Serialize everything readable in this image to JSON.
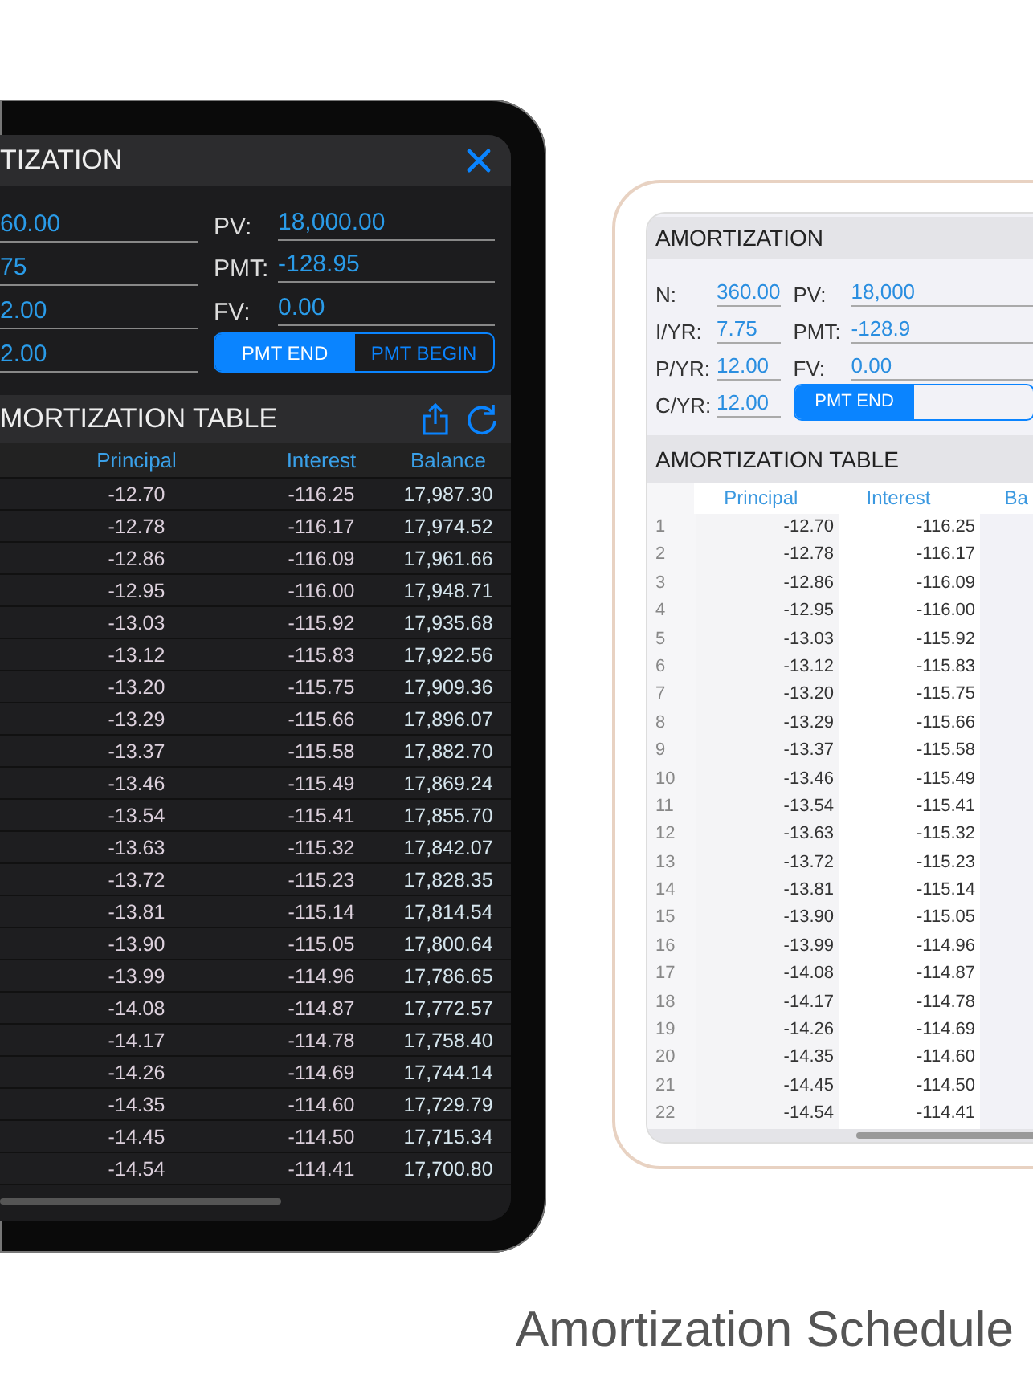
{
  "devices": [
    {
      "kind": "dark",
      "title": "TIZATION",
      "close": true,
      "left_fields": [
        {
          "value": "60.00"
        },
        {
          "value": "75"
        },
        {
          "value": "2.00"
        },
        {
          "value": "2.00"
        }
      ],
      "right_fields": [
        {
          "label": "PV:",
          "value": "18,000.00"
        },
        {
          "label": "PMT:",
          "value": "-128.95"
        },
        {
          "label": "FV:",
          "value": "0.00"
        }
      ],
      "segments": [
        {
          "label": "PMT END",
          "selected": true
        },
        {
          "label": "PMT BEGIN",
          "selected": false
        }
      ],
      "table_title": "MORTIZATION TABLE",
      "table_actions": true,
      "columns": [
        "Principal",
        "Interest",
        "Balance"
      ],
      "rows": [
        {
          "cells": [
            "-12.70",
            "-116.25",
            "17,987.30"
          ]
        },
        {
          "cells": [
            "-12.78",
            "-116.17",
            "17,974.52"
          ]
        },
        {
          "cells": [
            "-12.86",
            "-116.09",
            "17,961.66"
          ]
        },
        {
          "cells": [
            "-12.95",
            "-116.00",
            "17,948.71"
          ]
        },
        {
          "cells": [
            "-13.03",
            "-115.92",
            "17,935.68"
          ]
        },
        {
          "cells": [
            "-13.12",
            "-115.83",
            "17,922.56"
          ]
        },
        {
          "cells": [
            "-13.20",
            "-115.75",
            "17,909.36"
          ]
        },
        {
          "cells": [
            "-13.29",
            "-115.66",
            "17,896.07"
          ]
        },
        {
          "cells": [
            "-13.37",
            "-115.58",
            "17,882.70"
          ]
        },
        {
          "cells": [
            "-13.46",
            "-115.49",
            "17,869.24"
          ]
        },
        {
          "cells": [
            "-13.54",
            "-115.41",
            "17,855.70"
          ]
        },
        {
          "cells": [
            "-13.63",
            "-115.32",
            "17,842.07"
          ]
        },
        {
          "cells": [
            "-13.72",
            "-115.23",
            "17,828.35"
          ]
        },
        {
          "cells": [
            "-13.81",
            "-115.14",
            "17,814.54"
          ]
        },
        {
          "cells": [
            "-13.90",
            "-115.05",
            "17,800.64"
          ]
        },
        {
          "cells": [
            "-13.99",
            "-114.96",
            "17,786.65"
          ]
        },
        {
          "cells": [
            "-14.08",
            "-114.87",
            "17,772.57"
          ]
        },
        {
          "cells": [
            "-14.17",
            "-114.78",
            "17,758.40"
          ]
        },
        {
          "cells": [
            "-14.26",
            "-114.69",
            "17,744.14"
          ]
        },
        {
          "cells": [
            "-14.35",
            "-114.60",
            "17,729.79"
          ]
        },
        {
          "cells": [
            "-14.45",
            "-114.50",
            "17,715.34"
          ]
        },
        {
          "cells": [
            "-14.54",
            "-114.41",
            "17,700.80"
          ]
        }
      ]
    },
    {
      "kind": "light",
      "title": "AMORTIZATION",
      "close": false,
      "left_fields": [
        {
          "label": "N:",
          "value": "360.00"
        },
        {
          "label": "I/YR:",
          "value": "7.75"
        },
        {
          "label": "P/YR:",
          "value": "12.00"
        },
        {
          "label": "C/YR:",
          "value": "12.00"
        }
      ],
      "right_fields": [
        {
          "label": "PV:",
          "value": "18,000"
        },
        {
          "label": "PMT:",
          "value": "-128.9"
        },
        {
          "label": "FV:",
          "value": "0.00"
        }
      ],
      "segments": [
        {
          "label": "PMT END",
          "selected": true
        },
        {
          "selected": false
        }
      ],
      "table_title": "AMORTIZATION TABLE",
      "table_actions": false,
      "columns": [
        "Principal",
        "Interest",
        "Ba"
      ],
      "rows": [
        {
          "number": "1",
          "cells": [
            "-12.70",
            "-116.25"
          ]
        },
        {
          "number": "2",
          "cells": [
            "-12.78",
            "-116.17"
          ]
        },
        {
          "number": "3",
          "cells": [
            "-12.86",
            "-116.09"
          ]
        },
        {
          "number": "4",
          "cells": [
            "-12.95",
            "-116.00"
          ]
        },
        {
          "number": "5",
          "cells": [
            "-13.03",
            "-115.92"
          ]
        },
        {
          "number": "6",
          "cells": [
            "-13.12",
            "-115.83"
          ]
        },
        {
          "number": "7",
          "cells": [
            "-13.20",
            "-115.75"
          ]
        },
        {
          "number": "8",
          "cells": [
            "-13.29",
            "-115.66"
          ]
        },
        {
          "number": "9",
          "cells": [
            "-13.37",
            "-115.58"
          ]
        },
        {
          "number": "10",
          "cells": [
            "-13.46",
            "-115.49"
          ]
        },
        {
          "number": "11",
          "cells": [
            "-13.54",
            "-115.41"
          ]
        },
        {
          "number": "12",
          "cells": [
            "-13.63",
            "-115.32"
          ]
        },
        {
          "number": "13",
          "cells": [
            "-13.72",
            "-115.23"
          ]
        },
        {
          "number": "14",
          "cells": [
            "-13.81",
            "-115.14"
          ]
        },
        {
          "number": "15",
          "cells": [
            "-13.90",
            "-115.05"
          ]
        },
        {
          "number": "16",
          "cells": [
            "-13.99",
            "-114.96"
          ]
        },
        {
          "number": "17",
          "cells": [
            "-14.08",
            "-114.87"
          ]
        },
        {
          "number": "18",
          "cells": [
            "-14.17",
            "-114.78"
          ]
        },
        {
          "number": "19",
          "cells": [
            "-14.26",
            "-114.69"
          ]
        },
        {
          "number": "20",
          "cells": [
            "-14.35",
            "-114.60"
          ]
        },
        {
          "number": "21",
          "cells": [
            "-14.45",
            "-114.50"
          ]
        },
        {
          "number": "22",
          "cells": [
            "-14.54",
            "-114.41"
          ]
        }
      ]
    }
  ],
  "caption": "Amortization Schedule"
}
